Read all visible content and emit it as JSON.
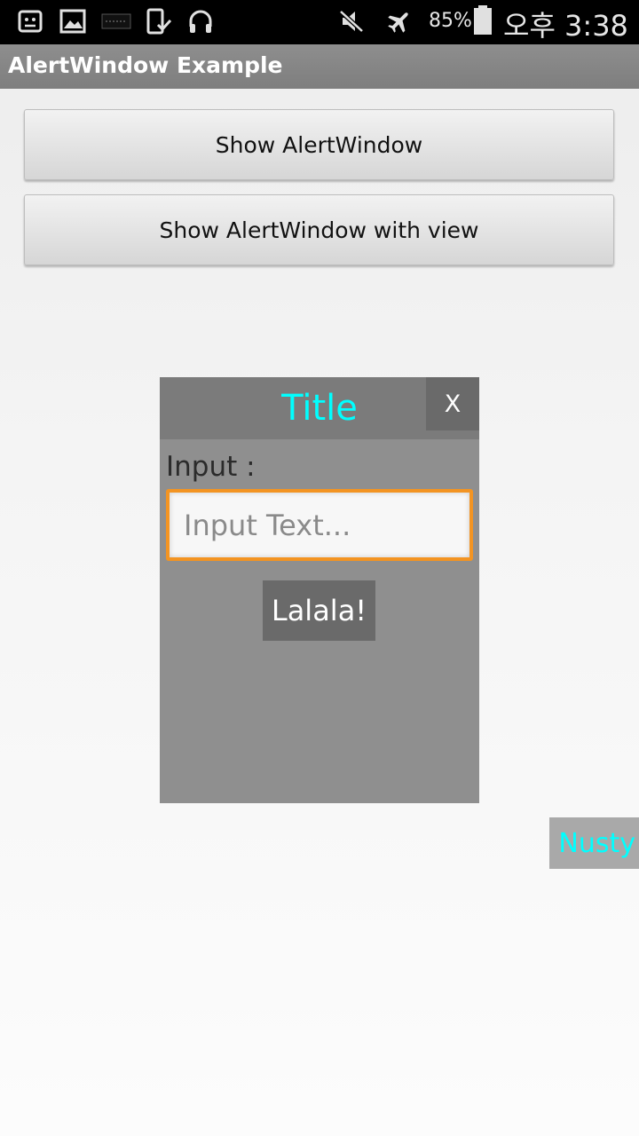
{
  "status_bar": {
    "battery": "85%",
    "time": "오후 3:38",
    "left_icons": [
      "sync-icon",
      "gallery-icon",
      "app-icon",
      "download-icon",
      "headphones-icon"
    ],
    "right_icons": [
      "mute-icon",
      "airplane-icon",
      "battery-icon"
    ]
  },
  "action_bar": {
    "title": "AlertWindow Example"
  },
  "buttons": {
    "show_alert": "Show AlertWindow",
    "show_alert_view": "Show AlertWindow with view"
  },
  "alert_window": {
    "title": "Title",
    "close_label": "X",
    "input_label": "Input :",
    "input_placeholder": "Input Text...",
    "input_value": "",
    "action_label": "Lalala!",
    "title_color": "#00ffff",
    "input_border_color": "#f39422"
  },
  "floating_tag": {
    "label": "Nusty"
  }
}
